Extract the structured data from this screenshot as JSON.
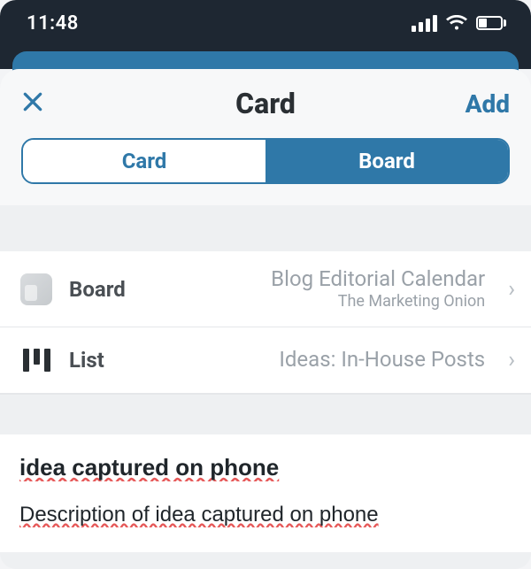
{
  "status": {
    "time": "11:48"
  },
  "nav": {
    "title": "Card",
    "add_label": "Add"
  },
  "segmented": {
    "options": [
      "Card",
      "Board"
    ],
    "selected_index": 0
  },
  "selectors": {
    "board": {
      "label": "Board",
      "value": "Blog Editorial Calendar",
      "subtitle": "The Marketing Onion"
    },
    "list": {
      "label": "List",
      "value": "Ideas: In-House Posts"
    }
  },
  "card": {
    "title": "idea captured on phone",
    "description": "Description of idea captured on phone"
  }
}
